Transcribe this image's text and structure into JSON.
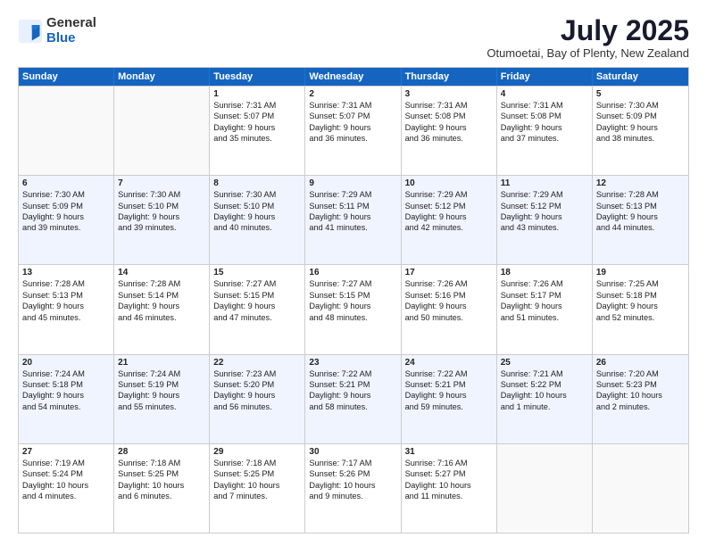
{
  "header": {
    "logo_general": "General",
    "logo_blue": "Blue",
    "month_title": "July 2025",
    "subtitle": "Otumoetai, Bay of Plenty, New Zealand"
  },
  "days_of_week": [
    "Sunday",
    "Monday",
    "Tuesday",
    "Wednesday",
    "Thursday",
    "Friday",
    "Saturday"
  ],
  "rows": [
    {
      "alt": false,
      "cells": [
        {
          "day": "",
          "lines": []
        },
        {
          "day": "",
          "lines": []
        },
        {
          "day": "1",
          "lines": [
            "Sunrise: 7:31 AM",
            "Sunset: 5:07 PM",
            "Daylight: 9 hours",
            "and 35 minutes."
          ]
        },
        {
          "day": "2",
          "lines": [
            "Sunrise: 7:31 AM",
            "Sunset: 5:07 PM",
            "Daylight: 9 hours",
            "and 36 minutes."
          ]
        },
        {
          "day": "3",
          "lines": [
            "Sunrise: 7:31 AM",
            "Sunset: 5:08 PM",
            "Daylight: 9 hours",
            "and 36 minutes."
          ]
        },
        {
          "day": "4",
          "lines": [
            "Sunrise: 7:31 AM",
            "Sunset: 5:08 PM",
            "Daylight: 9 hours",
            "and 37 minutes."
          ]
        },
        {
          "day": "5",
          "lines": [
            "Sunrise: 7:30 AM",
            "Sunset: 5:09 PM",
            "Daylight: 9 hours",
            "and 38 minutes."
          ]
        }
      ]
    },
    {
      "alt": true,
      "cells": [
        {
          "day": "6",
          "lines": [
            "Sunrise: 7:30 AM",
            "Sunset: 5:09 PM",
            "Daylight: 9 hours",
            "and 39 minutes."
          ]
        },
        {
          "day": "7",
          "lines": [
            "Sunrise: 7:30 AM",
            "Sunset: 5:10 PM",
            "Daylight: 9 hours",
            "and 39 minutes."
          ]
        },
        {
          "day": "8",
          "lines": [
            "Sunrise: 7:30 AM",
            "Sunset: 5:10 PM",
            "Daylight: 9 hours",
            "and 40 minutes."
          ]
        },
        {
          "day": "9",
          "lines": [
            "Sunrise: 7:29 AM",
            "Sunset: 5:11 PM",
            "Daylight: 9 hours",
            "and 41 minutes."
          ]
        },
        {
          "day": "10",
          "lines": [
            "Sunrise: 7:29 AM",
            "Sunset: 5:12 PM",
            "Daylight: 9 hours",
            "and 42 minutes."
          ]
        },
        {
          "day": "11",
          "lines": [
            "Sunrise: 7:29 AM",
            "Sunset: 5:12 PM",
            "Daylight: 9 hours",
            "and 43 minutes."
          ]
        },
        {
          "day": "12",
          "lines": [
            "Sunrise: 7:28 AM",
            "Sunset: 5:13 PM",
            "Daylight: 9 hours",
            "and 44 minutes."
          ]
        }
      ]
    },
    {
      "alt": false,
      "cells": [
        {
          "day": "13",
          "lines": [
            "Sunrise: 7:28 AM",
            "Sunset: 5:13 PM",
            "Daylight: 9 hours",
            "and 45 minutes."
          ]
        },
        {
          "day": "14",
          "lines": [
            "Sunrise: 7:28 AM",
            "Sunset: 5:14 PM",
            "Daylight: 9 hours",
            "and 46 minutes."
          ]
        },
        {
          "day": "15",
          "lines": [
            "Sunrise: 7:27 AM",
            "Sunset: 5:15 PM",
            "Daylight: 9 hours",
            "and 47 minutes."
          ]
        },
        {
          "day": "16",
          "lines": [
            "Sunrise: 7:27 AM",
            "Sunset: 5:15 PM",
            "Daylight: 9 hours",
            "and 48 minutes."
          ]
        },
        {
          "day": "17",
          "lines": [
            "Sunrise: 7:26 AM",
            "Sunset: 5:16 PM",
            "Daylight: 9 hours",
            "and 50 minutes."
          ]
        },
        {
          "day": "18",
          "lines": [
            "Sunrise: 7:26 AM",
            "Sunset: 5:17 PM",
            "Daylight: 9 hours",
            "and 51 minutes."
          ]
        },
        {
          "day": "19",
          "lines": [
            "Sunrise: 7:25 AM",
            "Sunset: 5:18 PM",
            "Daylight: 9 hours",
            "and 52 minutes."
          ]
        }
      ]
    },
    {
      "alt": true,
      "cells": [
        {
          "day": "20",
          "lines": [
            "Sunrise: 7:24 AM",
            "Sunset: 5:18 PM",
            "Daylight: 9 hours",
            "and 54 minutes."
          ]
        },
        {
          "day": "21",
          "lines": [
            "Sunrise: 7:24 AM",
            "Sunset: 5:19 PM",
            "Daylight: 9 hours",
            "and 55 minutes."
          ]
        },
        {
          "day": "22",
          "lines": [
            "Sunrise: 7:23 AM",
            "Sunset: 5:20 PM",
            "Daylight: 9 hours",
            "and 56 minutes."
          ]
        },
        {
          "day": "23",
          "lines": [
            "Sunrise: 7:22 AM",
            "Sunset: 5:21 PM",
            "Daylight: 9 hours",
            "and 58 minutes."
          ]
        },
        {
          "day": "24",
          "lines": [
            "Sunrise: 7:22 AM",
            "Sunset: 5:21 PM",
            "Daylight: 9 hours",
            "and 59 minutes."
          ]
        },
        {
          "day": "25",
          "lines": [
            "Sunrise: 7:21 AM",
            "Sunset: 5:22 PM",
            "Daylight: 10 hours",
            "and 1 minute."
          ]
        },
        {
          "day": "26",
          "lines": [
            "Sunrise: 7:20 AM",
            "Sunset: 5:23 PM",
            "Daylight: 10 hours",
            "and 2 minutes."
          ]
        }
      ]
    },
    {
      "alt": false,
      "cells": [
        {
          "day": "27",
          "lines": [
            "Sunrise: 7:19 AM",
            "Sunset: 5:24 PM",
            "Daylight: 10 hours",
            "and 4 minutes."
          ]
        },
        {
          "day": "28",
          "lines": [
            "Sunrise: 7:18 AM",
            "Sunset: 5:25 PM",
            "Daylight: 10 hours",
            "and 6 minutes."
          ]
        },
        {
          "day": "29",
          "lines": [
            "Sunrise: 7:18 AM",
            "Sunset: 5:25 PM",
            "Daylight: 10 hours",
            "and 7 minutes."
          ]
        },
        {
          "day": "30",
          "lines": [
            "Sunrise: 7:17 AM",
            "Sunset: 5:26 PM",
            "Daylight: 10 hours",
            "and 9 minutes."
          ]
        },
        {
          "day": "31",
          "lines": [
            "Sunrise: 7:16 AM",
            "Sunset: 5:27 PM",
            "Daylight: 10 hours",
            "and 11 minutes."
          ]
        },
        {
          "day": "",
          "lines": []
        },
        {
          "day": "",
          "lines": []
        }
      ]
    }
  ]
}
